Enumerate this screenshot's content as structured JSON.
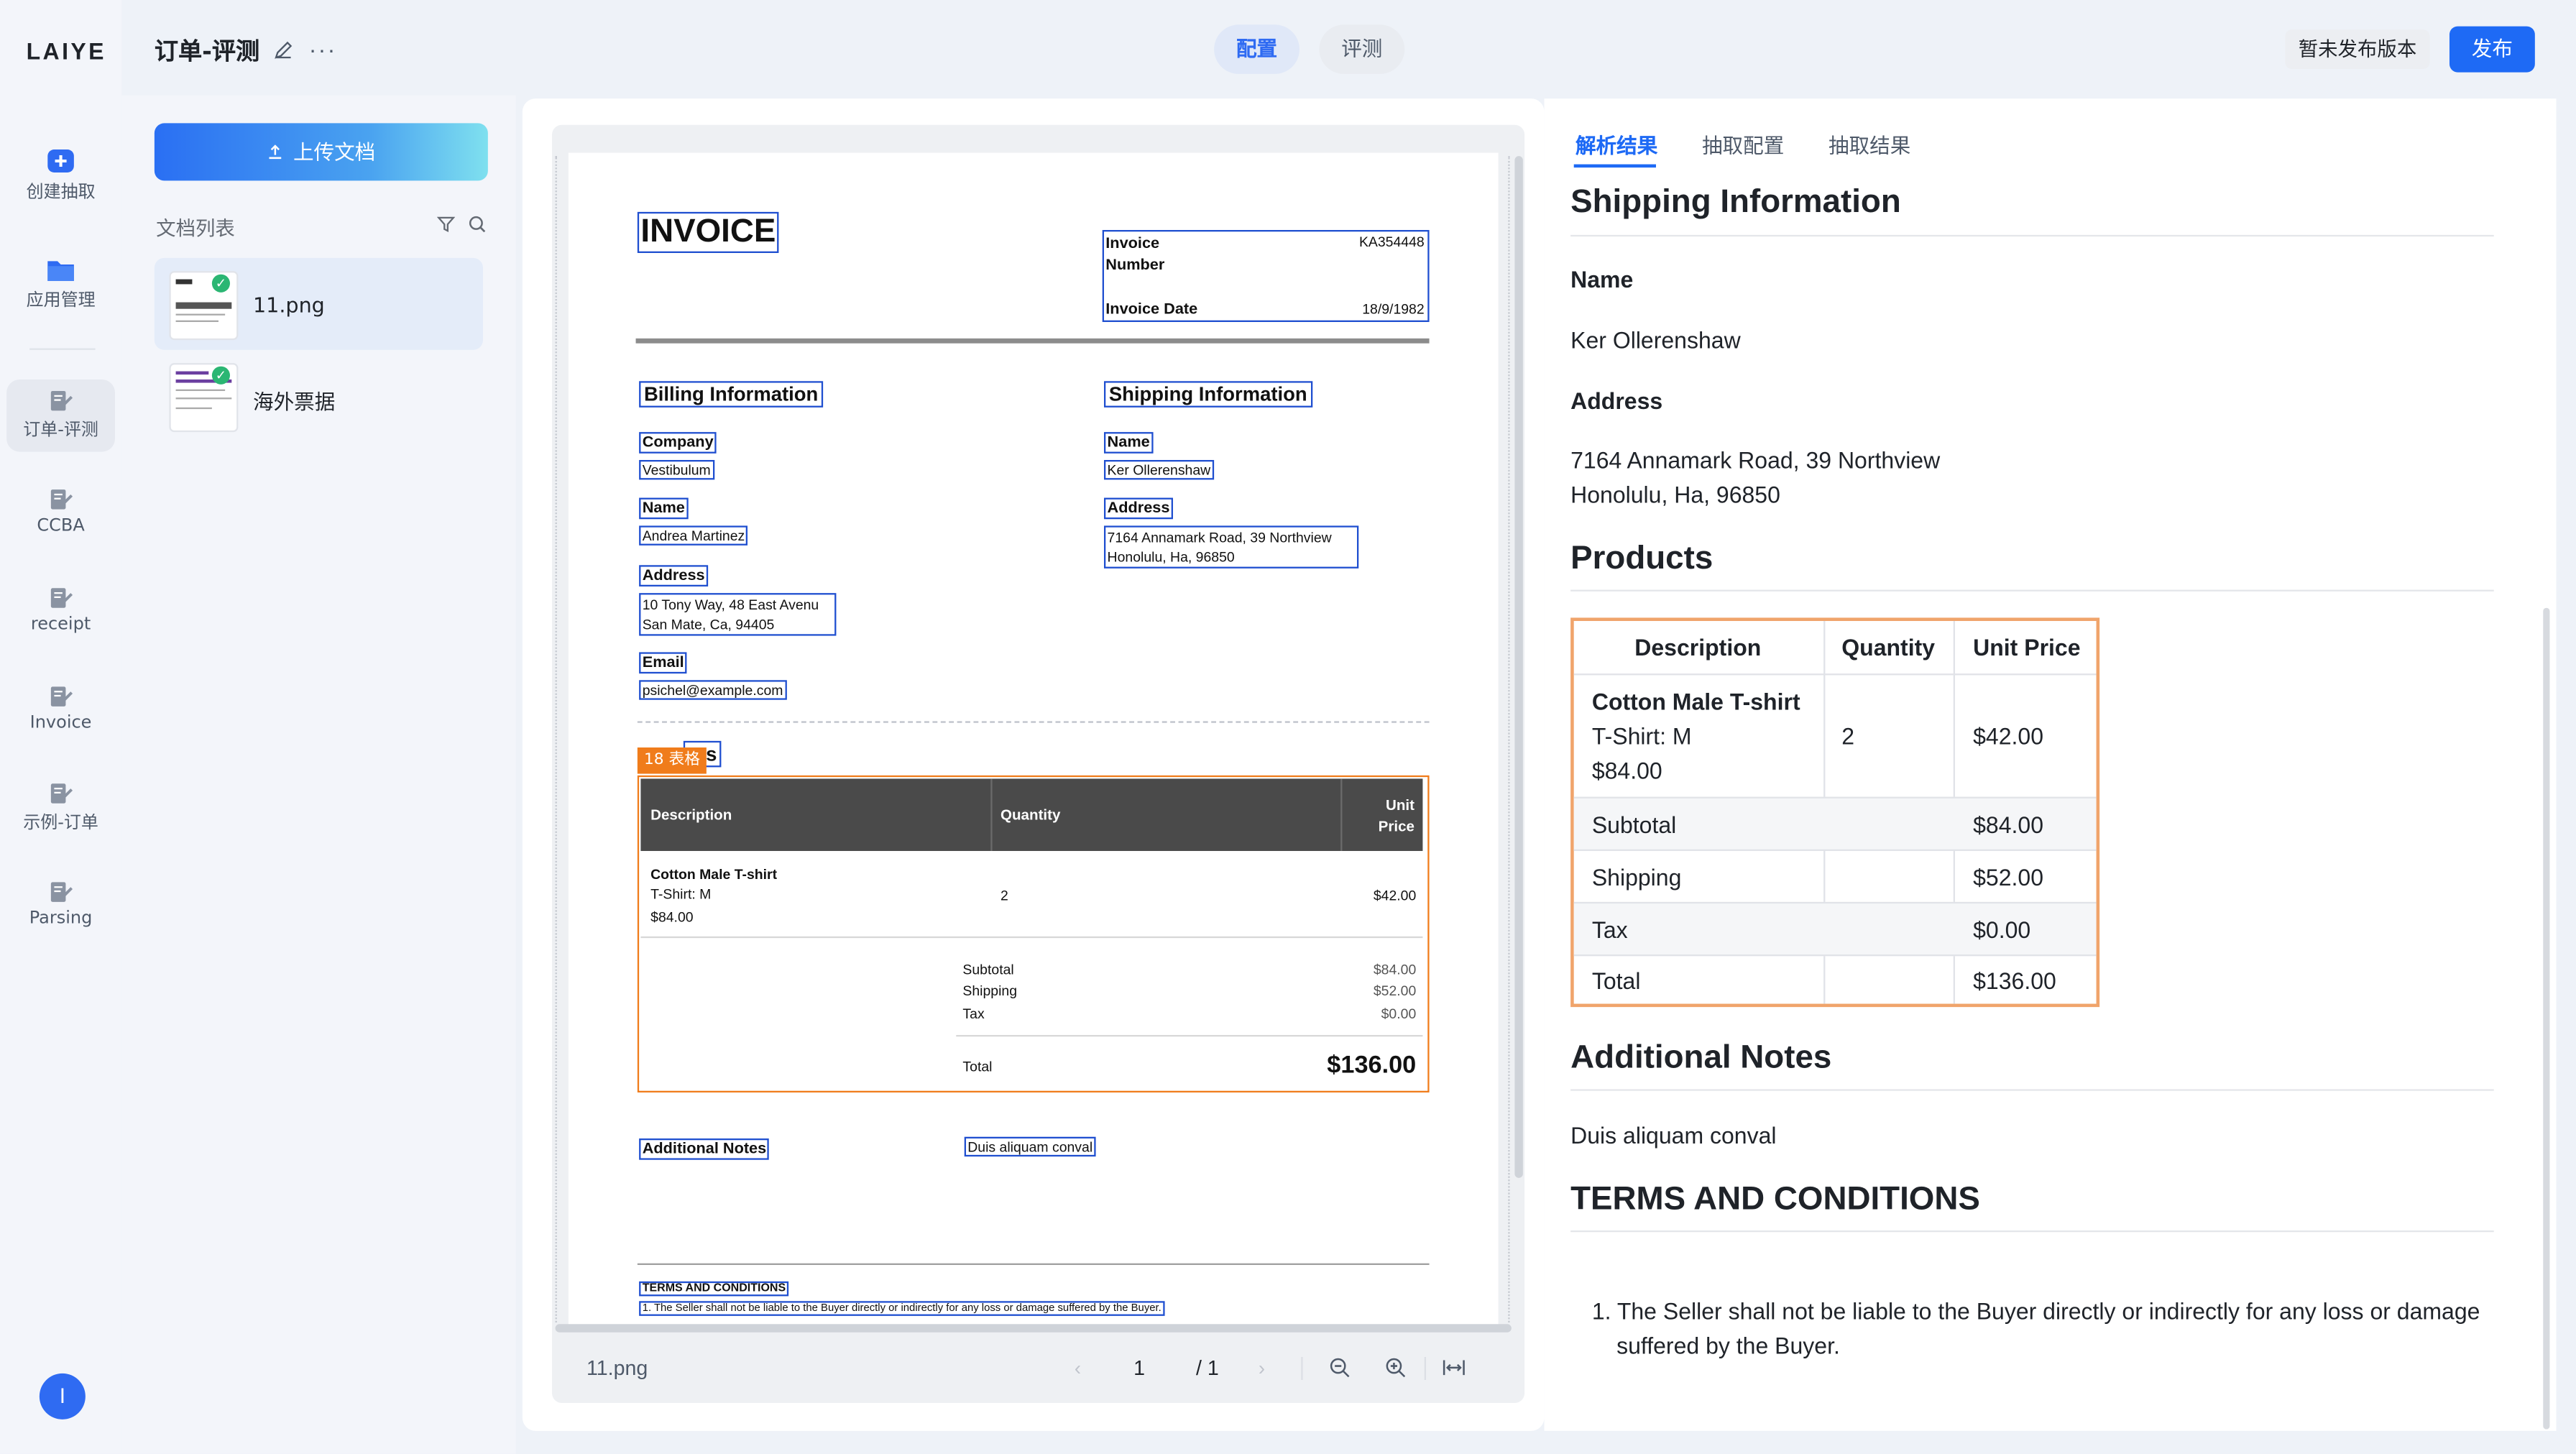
{
  "brand": {
    "logo": "LAIYE",
    "accent": "#1e6af5"
  },
  "nav": {
    "items": [
      {
        "label": "创建抽取",
        "icon": "create-extract-icon"
      },
      {
        "label": "应用管理",
        "icon": "folder-icon"
      },
      {
        "label": "订单-评测",
        "icon": "document-edit-icon"
      },
      {
        "label": "CCBA",
        "icon": "document-edit-icon"
      },
      {
        "label": "receipt",
        "icon": "document-edit-icon"
      },
      {
        "label": "Invoice",
        "icon": "document-edit-icon"
      },
      {
        "label": "示例-订单",
        "icon": "document-edit-icon"
      },
      {
        "label": "Parsing",
        "icon": "document-edit-icon"
      }
    ],
    "user_initial": "I"
  },
  "header": {
    "title": "订单-评测",
    "more": "···",
    "tabs": [
      "配置",
      "评测"
    ],
    "version_label": "暂未发布版本",
    "publish_label": "发布"
  },
  "docs": {
    "upload_label": "上传文档",
    "list_title": "文档列表",
    "items": [
      {
        "name": "11.png"
      },
      {
        "name": "海外票据"
      }
    ]
  },
  "preview": {
    "file_name": "11.png",
    "page_current": "1",
    "page_total": "/ 1",
    "table_tag": "18 表格",
    "invoice": {
      "title": "INVOICE",
      "invoice_number_label": "Invoice Number",
      "invoice_number": "KA354448",
      "invoice_date_label": "Invoice Date",
      "invoice_date": "18/9/1982",
      "billing_title": "Billing Information",
      "company_label": "Company",
      "company": "Vestibulum",
      "name_label": "Name",
      "billing_name": "Andrea Martinez",
      "address_label": "Address",
      "billing_address_1": "10 Tony Way, 48 East Avenu",
      "billing_address_2": "San Mate, Ca, 94405",
      "email_label": "Email",
      "email": "psichel@example.com",
      "shipping_title": "Shipping Information",
      "shipping_name": "Ker Ollerenshaw",
      "shipping_address_1": "7164 Annamark Road, 39 Northview",
      "shipping_address_2": "Honolulu, Ha, 96850",
      "products_partial": "cts",
      "col_description": "Description",
      "col_quantity": "Quantity",
      "col_unit": "Unit",
      "col_price": "Price",
      "item_name": "Cotton Male T-shirt",
      "item_variant": "T-Shirt: M",
      "item_total": "$84.00",
      "item_qty": "2",
      "item_price": "$42.00",
      "subtotal_label": "Subtotal",
      "shipping_label": "Shipping",
      "tax_label": "Tax",
      "subtotal": "$84.00",
      "shipping": "$52.00",
      "tax": "$0.00",
      "total_label": "Total",
      "total": "$136.00",
      "notes_label": "Additional Notes",
      "notes": "Duis aliquam conval",
      "terms_title": "TERMS AND CONDITIONS",
      "terms_1": "1. The Seller shall not be liable to the Buyer directly or indirectly for any loss or damage suffered by the Buyer."
    }
  },
  "result": {
    "tabs": [
      "解析结果",
      "抽取配置",
      "抽取结果"
    ],
    "shipping_heading": "Shipping Information",
    "name_label": "Name",
    "name_value": "Ker Ollerenshaw",
    "address_label": "Address",
    "address_line1": "7164 Annamark Road, 39 Northview",
    "address_line2": "Honolulu, Ha, 96850",
    "products_heading": "Products",
    "table": {
      "headers": [
        "Description",
        "Quantity",
        "Unit Price"
      ],
      "item_line1": "Cotton Male T-shirt",
      "item_line2": "T-Shirt: M",
      "item_line3": "$84.00",
      "item_qty": "2",
      "item_price": "$42.00",
      "subtotal_label": "Subtotal",
      "subtotal": "$84.00",
      "shipping_label": "Shipping",
      "shipping": "$52.00",
      "tax_label": "Tax",
      "tax": "$0.00",
      "total_label": "Total",
      "total": "$136.00"
    },
    "notes_heading": "Additional Notes",
    "notes": "Duis aliquam conval",
    "terms_heading": "TERMS AND CONDITIONS",
    "terms_1_a": "1. The Seller shall not be liable to the Buyer directly or indirectly for any loss or damage",
    "terms_1_b": "suffered by the Buyer."
  }
}
